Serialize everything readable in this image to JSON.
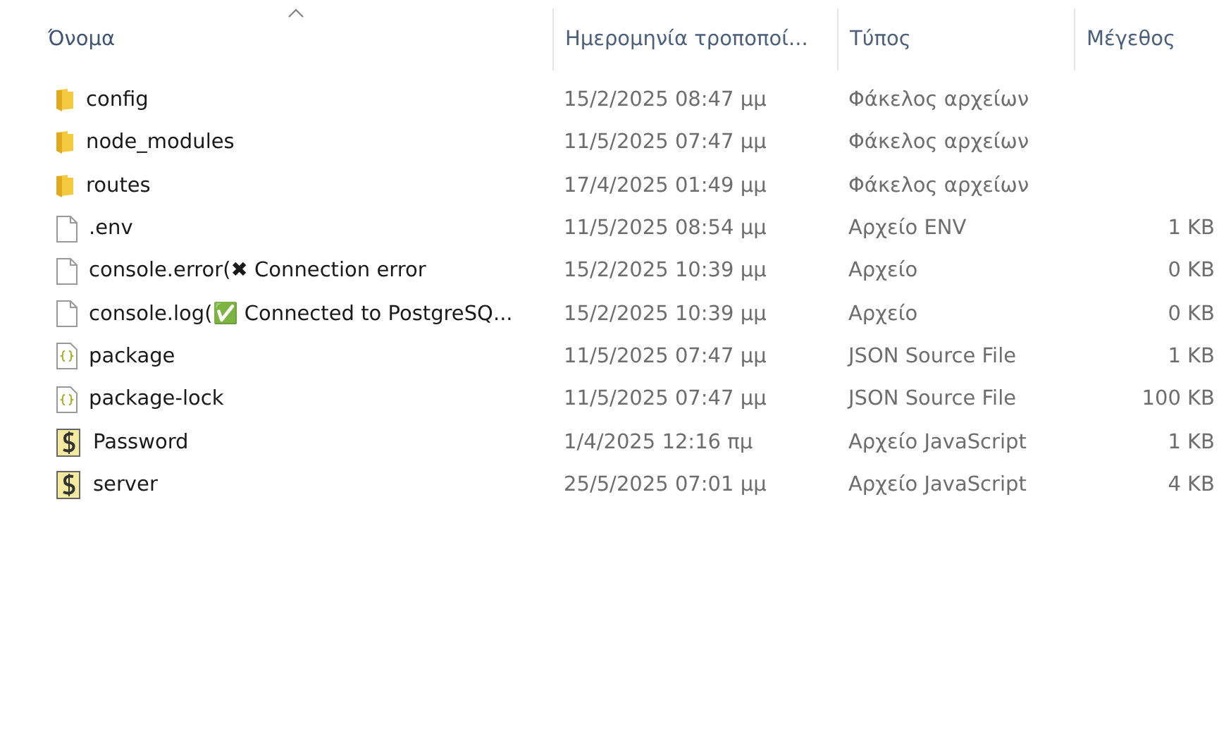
{
  "table": {
    "columns": [
      {
        "label": "Όνομα",
        "sorted": true
      },
      {
        "label": "Ημερομηνία τροποποί...",
        "sorted": false
      },
      {
        "label": "Τύπος",
        "sorted": false
      },
      {
        "label": "Μέγεθος",
        "sorted": false
      }
    ],
    "rows": [
      {
        "kind": "folder",
        "name": "config",
        "modified": "15/2/2025 08:47 μμ",
        "type": "Φάκελος αρχείων"
      },
      {
        "kind": "folder",
        "name": "node_modules",
        "modified": "11/5/2025 07:47 μμ",
        "type": "Φάκελος αρχείων"
      },
      {
        "kind": "folder",
        "name": "routes",
        "modified": "17/4/2025 01:49 μμ",
        "type": "Φάκελος αρχείων"
      },
      {
        "kind": "file",
        "name": ".env",
        "modified": "11/5/2025 08:54 μμ",
        "type": "Αρχείο ENV",
        "size": "1 KB"
      },
      {
        "kind": "file",
        "name": "console.error(✖ Connection error",
        "modified": "15/2/2025 10:39 μμ",
        "type": "Αρχείο",
        "size": "0 KB"
      },
      {
        "kind": "file",
        "name": "console.log(✅ Connected to PostgreSQ...",
        "modified": "15/2/2025 10:39 μμ",
        "type": "Αρχείο",
        "size": "0 KB"
      },
      {
        "kind": "json",
        "name": "package",
        "modified": "11/5/2025 07:47 μμ",
        "type": "JSON Source File",
        "size": "1 KB"
      },
      {
        "kind": "json",
        "name": "package-lock",
        "modified": "11/5/2025 07:47 μμ",
        "type": "JSON Source File",
        "size": "100 KB"
      },
      {
        "kind": "script",
        "name": "Password",
        "modified": "1/4/2025 12:16 πμ",
        "type": "Αρχείο JavaScript",
        "size": "1 KB"
      },
      {
        "kind": "script",
        "name": "server",
        "modified": "25/5/2025 07:01 μμ",
        "type": "Αρχείο JavaScript",
        "size": "4 KB"
      }
    ]
  }
}
